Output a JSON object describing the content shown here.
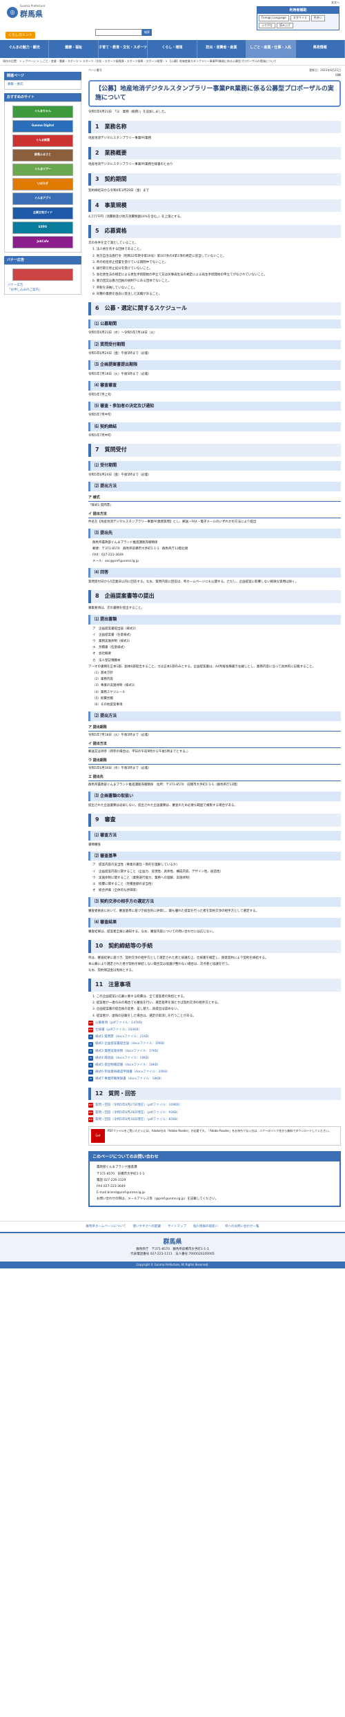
{
  "header": {
    "logo_sub": "Gunma Prefecture",
    "logo_title": "群馬県",
    "search_placeholder": "",
    "search_button": "検索",
    "util_top": "本文へ",
    "util_title": "利用者補助",
    "util_buttons": [
      "Foreign Language",
      "文字サイズ",
      "色合い",
      "ふりがな",
      "読み上げ"
    ],
    "useful_label": "くらしのヒント"
  },
  "gnav": [
    "ぐんまの魅力・観光",
    "健康・福祉",
    "子育て・教育・文化・スポーツ",
    "くらし・環境",
    "防災・消費者・産業",
    "しごと・産業・仕事・入札",
    "県政情報"
  ],
  "breadcrumb": "現在の位置：トップページ > しごと・産業・農業・スポーツ > スポーツ（文化・スポーツ振興課・スポーツ振興・スポーツ政策）> 【公募】地域産業スタンプラリー事業PR業務に係る公募型プロポーザルの実施について",
  "sidebar": {
    "section_title": "関連ページ",
    "related": [
      "募集・委託"
    ],
    "recommend_title": "おすすめのサイト",
    "banners": [
      {
        "label": "ぐんまちゃん",
        "color": "#3d9a3d"
      },
      {
        "label": "Gunma Digital",
        "color": "#2b6fba"
      },
      {
        "label": "ぐんま新聞",
        "color": "#c33"
      },
      {
        "label": "群馬ふるさと",
        "color": "#8b5e3c"
      },
      {
        "label": "ぐんまツアー",
        "color": "#6aa84f"
      },
      {
        "label": "いばらぎ",
        "color": "#e07b00"
      },
      {
        "label": "ぐんまアプリ",
        "color": "#3a6fb5"
      },
      {
        "label": "企業立地ガイド",
        "color": "#1e5aa8"
      },
      {
        "label": "EXPO",
        "color": "#0a7c9c"
      },
      {
        "label": "JobCafe",
        "color": "#8b1e8b"
      }
    ],
    "banner_title": "バナー広告",
    "ad_links": [
      "バナー広告",
      "「お申し込みのご案内」"
    ]
  },
  "page": {
    "update_label": "ページ番号",
    "update_value": "更新日：2023年6月21日",
    "print": "印刷",
    "title": "【公募】地産地消デジタルスタンプラリー事業PR業務に係る公募型プロポーザルの実施について",
    "intro": "令和5年6月21日　「⑴　業務（総務）」を追加しました。"
  },
  "sections": [
    {
      "h": "1　業務名称",
      "body": "地産地消デジタルスタンプラリー事業PR業務"
    },
    {
      "h": "2　業務概要",
      "body": "地産地消デジタルスタンプラリー事業PR業務仕様書のとおり"
    },
    {
      "h": "3　契約期間",
      "body": "契約締結日から令和6年3月29日（金）まで"
    },
    {
      "h": "4　事業規模",
      "body": "4,777千円（消費税及び地方消費税額10%を含む。）を上限とする。"
    }
  ],
  "s5": {
    "h": "5　応募資格",
    "intro": "次の条件を全て満たしていること。",
    "items": [
      "1. 法人格を有する団体であること。",
      "2. 地方自治法施行令（昭和22年政令第16号）第167条の4第1項の規定に該当していないこと。",
      "3. 県の指名停止措置を受けている期間中でないこと。",
      "4. 銀行取引停止処分を受けていないこと。",
      "5. 会社更生法の規定による更生手続開始の申立て又は民事再生法の規定による再生手続開始の申立てがなされていないこと。",
      "6. 暴力団又は暴力団員の統制下にある団体でないこと。",
      "7. 県税を滞納していないこと。",
      "8. 同種の業務を過去に受注した実績があること。"
    ]
  },
  "s6": {
    "h": "6　公募・選定に関するスケジュール",
    "subs": [
      {
        "h": "⑴ 公募期間",
        "body": "令和5年6月21日（水）～令和5年7月18日（火）"
      },
      {
        "h": "⑵ 質問受付期間",
        "body": "令和5年6月24日（金）午後5時まで（必着）"
      },
      {
        "h": "⑶ 企画提案書提出期限",
        "body": "令和5年7月18日（火）午後5時まで（必着）"
      },
      {
        "h": "⑷ 審査審査",
        "body": "令和5年7月上旬"
      },
      {
        "h": "⑸ 審査・参加者の決定及び通知",
        "body": "令和5年7月中旬"
      },
      {
        "h": "⑹ 契約締結",
        "body": "令和5年7月中旬"
      }
    ]
  },
  "s7": {
    "h": "7　質問受付",
    "subs": [
      {
        "h": "⑴ 受付期間",
        "body": "令和5年6月24日（金）午後5時まで（必着）"
      },
      {
        "h": "⑵ 提出方法",
        "body": ""
      }
    ],
    "a_label": "ア 様式",
    "a_body": "「様式1 質問票」",
    "b_label": "イ 提出方法",
    "b_body": "件名を【地産地消デジタルスタンプラリー事業PR業務質問】とし、郵送・FAX・電子メールのいずれかの方法により提出",
    "sub3_h": "⑶ 提出先",
    "address": [
      "群馬県農政部ぐんまブランド推進課販売戦略係",
      "郵便：〒371-8570　群馬県前橋市大手町1-1-1　群馬県庁13階北側",
      "FAX：027-223-3649",
      "メール：sec@pref.gunma.lg.jp"
    ],
    "sub4_h": "⑷ 回答",
    "sub4_body": "質問受付日から5営業日以内に回答する。なお、質問内容に回答は、県ホームページにも公開する。ただし、企画提案に影響しない軽微な質問は除く。"
  },
  "s8": {
    "h": "8　企画提案書等の提出",
    "intro": "募集要項は、次の書類を提出すること。",
    "sub1_h": "⑴ 提出書類",
    "docs": [
      "ア　企画提案書提出届（様式2）",
      "イ　企画提案書（任意様式）",
      "ウ　業務実施体制（様式3）",
      "エ　見積書（任意様式）",
      "オ　会社概要",
      "カ　法人登記簿謄本"
    ],
    "doc_note": "ア～オの書類を正本1部、副本6部提出すること。カは正本1部のみとする。企画提案書は、A4判縦長横書き左綴じとし、業務内容に沿って具体的に記載すること。",
    "checks": [
      "（1）基本方針",
      "（2）業務内容",
      "（3）事業の実施体制（様式3）",
      "（4）業務スケジュール",
      "（5）経費見積",
      "（6）その他提案事項"
    ],
    "sub2_h": "⑵ 提出方法",
    "a_label": "ア 提出期限",
    "a_body": "令和5年7月18日（火）午後5時まで（必着）",
    "b_label": "イ 提出方法",
    "b_body": "郵送又は持参（持参の場合は、平日の午前9時から午後5時までとする。）",
    "c_label": "ウ 提出期限",
    "c_body": "令和5年6月30日（水）午後5時まで（必着）",
    "d_label": "エ 提出先",
    "d_body": "群馬県農政部ぐんまブランド推進課販売戦略係　住所：〒371-8570　前橋市大手町1-1-1（群馬県庁13階）",
    "sub3_h": "⑶ 企画書類の取扱い",
    "sub3_body": "提出された企画書類は返却しない。提出された企画書類は、審査のため必要な範囲で複製する場合がある。"
  },
  "s9": {
    "h": "9　審査",
    "sub1_h": "⑴ 審査方法",
    "sub1_body": "書類審査",
    "sub2_h": "⑵ 審査基準",
    "criteria": [
      "ア　提案内容の妥当性（事業の趣旨・目的を理解しているか）",
      "イ　企画提案内容に関すること（企画力、実現性、具体性、構成内容、デザイン性、創造性）",
      "ウ　実施体制に関すること（業務遂行能力、業務への理解、実施体制）",
      "エ　経費に関すること（見積金額の妥当性）",
      "オ　総合評価（全体的な評価等）"
    ],
    "sub3_h": "⑶ 契約交渉の相手方の選定方法",
    "sub3_body": "審査委員会において、審査基準に基づき総合的に評価し、最も優れた提案を行った者を契約交渉の相手方として選定する。",
    "sub4_h": "⑷ 審査結果",
    "sub4_body": "審査結果は、提案者全員に通知する。なお、審査内容についての問い合わせには応じない。"
  },
  "s10": {
    "h": "10　契約締結等の手続",
    "body1": "県は、審査結果に基づき、契約交渉の相手方として選定された者と協議の上、仕様書を確定し、随意契約により契約を締結する。",
    "body2": "本公募により選定された者が契約を締結しない場合又は協議が整わない場合は、次点者と協議を行う。",
    "body3": "なお、契約保証金は免除とする。"
  },
  "s11": {
    "h": "11　注意事項",
    "items": [
      "1. この企画提案に応募に要する経費は、全て提案者の負担とする。",
      "2. 提案者が一者のみの場合でも審査を行い、選定基準を満たせば契約交渉の相手方とする。",
      "3. 企画提案書の提出後の変更、差し替え、再提出は認めない。",
      "4. 提案者が、虚偽の記載をした場合は、選定の取消しを行うことがある。"
    ],
    "files": [
      {
        "label": "公募要項（pdfファイル：147KB）",
        "type": "pdf"
      },
      {
        "label": "仕様書（pdfファイル：204KB）",
        "type": "pdf"
      },
      {
        "label": "様式1 質問票（docxファイル：21KB）",
        "type": "doc"
      },
      {
        "label": "様式2 企画提案書提出届（docxファイル：19KB）",
        "type": "doc"
      },
      {
        "label": "様式3 業務実施体制（docxファイル：17KB）",
        "type": "doc"
      },
      {
        "label": "様式4 辞退届（docxファイル：18KB）",
        "type": "doc"
      },
      {
        "label": "様式5 提出物確認書（docxファイル：18KB）",
        "type": "doc"
      },
      {
        "label": "様式6 参加資格確認申請書（docxファイル：20KB）",
        "type": "doc"
      },
      {
        "label": "様式7 事業所概要調書（docxファイル：18KB）",
        "type": "doc"
      }
    ]
  },
  "s12": {
    "h": "12　質問・回答",
    "files": [
      {
        "label": "質問・回答（令和5年6月27日現在）（pdfファイル：109KB）",
        "type": "pdf"
      },
      {
        "label": "質問・回答（令和5年6月28日現在）（pdfファイル：92KB）",
        "type": "pdf"
      },
      {
        "label": "質問・回答（令和5年6月30日現在）（pdfファイル：85KB）",
        "type": "pdf"
      }
    ]
  },
  "pdf_note": {
    "icon": "Get Adobe Reader",
    "text": "PDFファイルをご覧いただくには、Adobe社の「Adobe Reader」が必要です。「Adobe Reader」をお持ちでない方は、バナーのリンク先から無料でダウンロードしてください。"
  },
  "contact": {
    "title": "このページについてのお問い合わせ",
    "lines": [
      "農政部ぐんまブランド推進課",
      "〒371-8570　前橋市大手町1-1-1",
      "電話 027-226-3129",
      "FAX 027-223-3649",
      "E-mail brand@pref.gunma.lg.jp",
      "お問い合わせの際は、メールアドレス等（@pref.gunma.lg.jp）を記載してください。"
    ]
  },
  "footer_links": [
    "群馬県ホームページについて",
    "使いやすさへの配慮",
    "サイトマップ",
    "個人情報の取扱い",
    "県へのお問い合わせ一覧"
  ],
  "footer": {
    "logo": "群馬県",
    "address": "群馬県庁　〒371-8570　群馬県前橋市大手町1-1-1",
    "tel": "代表電話番号 027-223-1111　法人番号 7000020100005"
  },
  "copyright": "Copyright © Gunma Prefecture. All Rights Reserved."
}
